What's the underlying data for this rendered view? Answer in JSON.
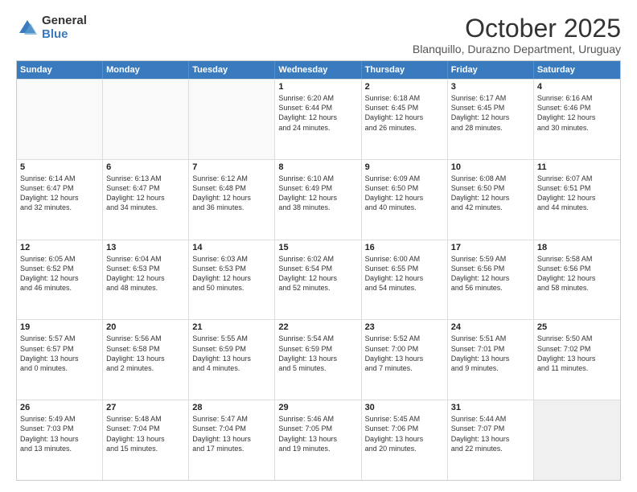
{
  "logo": {
    "general": "General",
    "blue": "Blue"
  },
  "title": "October 2025",
  "location": "Blanquillo, Durazno Department, Uruguay",
  "header_days": [
    "Sunday",
    "Monday",
    "Tuesday",
    "Wednesday",
    "Thursday",
    "Friday",
    "Saturday"
  ],
  "rows": [
    [
      {
        "day": "",
        "lines": [],
        "empty": true
      },
      {
        "day": "",
        "lines": [],
        "empty": true
      },
      {
        "day": "",
        "lines": [],
        "empty": true
      },
      {
        "day": "1",
        "lines": [
          "Sunrise: 6:20 AM",
          "Sunset: 6:44 PM",
          "Daylight: 12 hours",
          "and 24 minutes."
        ]
      },
      {
        "day": "2",
        "lines": [
          "Sunrise: 6:18 AM",
          "Sunset: 6:45 PM",
          "Daylight: 12 hours",
          "and 26 minutes."
        ]
      },
      {
        "day": "3",
        "lines": [
          "Sunrise: 6:17 AM",
          "Sunset: 6:45 PM",
          "Daylight: 12 hours",
          "and 28 minutes."
        ]
      },
      {
        "day": "4",
        "lines": [
          "Sunrise: 6:16 AM",
          "Sunset: 6:46 PM",
          "Daylight: 12 hours",
          "and 30 minutes."
        ]
      }
    ],
    [
      {
        "day": "5",
        "lines": [
          "Sunrise: 6:14 AM",
          "Sunset: 6:47 PM",
          "Daylight: 12 hours",
          "and 32 minutes."
        ]
      },
      {
        "day": "6",
        "lines": [
          "Sunrise: 6:13 AM",
          "Sunset: 6:47 PM",
          "Daylight: 12 hours",
          "and 34 minutes."
        ]
      },
      {
        "day": "7",
        "lines": [
          "Sunrise: 6:12 AM",
          "Sunset: 6:48 PM",
          "Daylight: 12 hours",
          "and 36 minutes."
        ]
      },
      {
        "day": "8",
        "lines": [
          "Sunrise: 6:10 AM",
          "Sunset: 6:49 PM",
          "Daylight: 12 hours",
          "and 38 minutes."
        ]
      },
      {
        "day": "9",
        "lines": [
          "Sunrise: 6:09 AM",
          "Sunset: 6:50 PM",
          "Daylight: 12 hours",
          "and 40 minutes."
        ]
      },
      {
        "day": "10",
        "lines": [
          "Sunrise: 6:08 AM",
          "Sunset: 6:50 PM",
          "Daylight: 12 hours",
          "and 42 minutes."
        ]
      },
      {
        "day": "11",
        "lines": [
          "Sunrise: 6:07 AM",
          "Sunset: 6:51 PM",
          "Daylight: 12 hours",
          "and 44 minutes."
        ]
      }
    ],
    [
      {
        "day": "12",
        "lines": [
          "Sunrise: 6:05 AM",
          "Sunset: 6:52 PM",
          "Daylight: 12 hours",
          "and 46 minutes."
        ]
      },
      {
        "day": "13",
        "lines": [
          "Sunrise: 6:04 AM",
          "Sunset: 6:53 PM",
          "Daylight: 12 hours",
          "and 48 minutes."
        ]
      },
      {
        "day": "14",
        "lines": [
          "Sunrise: 6:03 AM",
          "Sunset: 6:53 PM",
          "Daylight: 12 hours",
          "and 50 minutes."
        ]
      },
      {
        "day": "15",
        "lines": [
          "Sunrise: 6:02 AM",
          "Sunset: 6:54 PM",
          "Daylight: 12 hours",
          "and 52 minutes."
        ]
      },
      {
        "day": "16",
        "lines": [
          "Sunrise: 6:00 AM",
          "Sunset: 6:55 PM",
          "Daylight: 12 hours",
          "and 54 minutes."
        ]
      },
      {
        "day": "17",
        "lines": [
          "Sunrise: 5:59 AM",
          "Sunset: 6:56 PM",
          "Daylight: 12 hours",
          "and 56 minutes."
        ]
      },
      {
        "day": "18",
        "lines": [
          "Sunrise: 5:58 AM",
          "Sunset: 6:56 PM",
          "Daylight: 12 hours",
          "and 58 minutes."
        ]
      }
    ],
    [
      {
        "day": "19",
        "lines": [
          "Sunrise: 5:57 AM",
          "Sunset: 6:57 PM",
          "Daylight: 13 hours",
          "and 0 minutes."
        ]
      },
      {
        "day": "20",
        "lines": [
          "Sunrise: 5:56 AM",
          "Sunset: 6:58 PM",
          "Daylight: 13 hours",
          "and 2 minutes."
        ]
      },
      {
        "day": "21",
        "lines": [
          "Sunrise: 5:55 AM",
          "Sunset: 6:59 PM",
          "Daylight: 13 hours",
          "and 4 minutes."
        ]
      },
      {
        "day": "22",
        "lines": [
          "Sunrise: 5:54 AM",
          "Sunset: 6:59 PM",
          "Daylight: 13 hours",
          "and 5 minutes."
        ]
      },
      {
        "day": "23",
        "lines": [
          "Sunrise: 5:52 AM",
          "Sunset: 7:00 PM",
          "Daylight: 13 hours",
          "and 7 minutes."
        ]
      },
      {
        "day": "24",
        "lines": [
          "Sunrise: 5:51 AM",
          "Sunset: 7:01 PM",
          "Daylight: 13 hours",
          "and 9 minutes."
        ]
      },
      {
        "day": "25",
        "lines": [
          "Sunrise: 5:50 AM",
          "Sunset: 7:02 PM",
          "Daylight: 13 hours",
          "and 11 minutes."
        ]
      }
    ],
    [
      {
        "day": "26",
        "lines": [
          "Sunrise: 5:49 AM",
          "Sunset: 7:03 PM",
          "Daylight: 13 hours",
          "and 13 minutes."
        ]
      },
      {
        "day": "27",
        "lines": [
          "Sunrise: 5:48 AM",
          "Sunset: 7:04 PM",
          "Daylight: 13 hours",
          "and 15 minutes."
        ]
      },
      {
        "day": "28",
        "lines": [
          "Sunrise: 5:47 AM",
          "Sunset: 7:04 PM",
          "Daylight: 13 hours",
          "and 17 minutes."
        ]
      },
      {
        "day": "29",
        "lines": [
          "Sunrise: 5:46 AM",
          "Sunset: 7:05 PM",
          "Daylight: 13 hours",
          "and 19 minutes."
        ]
      },
      {
        "day": "30",
        "lines": [
          "Sunrise: 5:45 AM",
          "Sunset: 7:06 PM",
          "Daylight: 13 hours",
          "and 20 minutes."
        ]
      },
      {
        "day": "31",
        "lines": [
          "Sunrise: 5:44 AM",
          "Sunset: 7:07 PM",
          "Daylight: 13 hours",
          "and 22 minutes."
        ]
      },
      {
        "day": "",
        "lines": [],
        "empty": true,
        "shaded": true
      }
    ]
  ]
}
